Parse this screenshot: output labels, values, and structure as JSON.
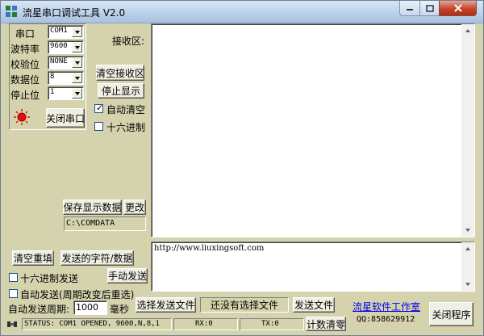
{
  "window": {
    "title": "流星串口调试工具 V2.0"
  },
  "settings": {
    "port_label": "串口",
    "port_value": "COM1",
    "baud_label": "波特率",
    "baud_value": "9600",
    "parity_label": "校验位",
    "parity_value": "NONE",
    "databits_label": "数据位",
    "databits_value": "8",
    "stopbits_label": "停止位",
    "stopbits_value": "1",
    "close_port_label": "关闭串口"
  },
  "receive": {
    "label": "接收区:",
    "clear_button": "清空接收区",
    "stop_display_button": "停止显示",
    "auto_clear_label": "自动清空",
    "auto_clear_checked": true,
    "hex_label": "十六进制",
    "hex_checked": false,
    "content": ""
  },
  "save": {
    "save_button": "保存显示数据",
    "change_button": "更改",
    "path": "C:\\COMDATA"
  },
  "send": {
    "content": "http://www.liuxingsoft.com",
    "clear_button": "清空重填",
    "sent_chars_button": "发送的字符/数据",
    "hex_send_label": "十六进制发送",
    "hex_send_checked": false,
    "manual_send_button": "手动发送",
    "auto_send_label": "自动发送(周期改变后重选)",
    "auto_send_checked": false,
    "period_label": "自动发送周期:",
    "period_value": "1000",
    "period_unit": "毫秒",
    "select_file_button": "选择发送文件",
    "file_status": "还没有选择文件",
    "send_file_button": "发送文件",
    "studio_link": "流星软件工作室",
    "qq": "QQ:858629912",
    "close_program_button": "关闭程序"
  },
  "statusbar": {
    "status": "STATUS: COM1 OPENED, 9600,N,8,1",
    "rx": "RX:0",
    "tx": "TX:0",
    "reset_count_button": "计数清零"
  },
  "colors": {
    "window_bg": "#d5d3ad",
    "title_gradient_top": "#d8e6f5",
    "close_red": "#c6432d",
    "led_red": "#e01010"
  }
}
